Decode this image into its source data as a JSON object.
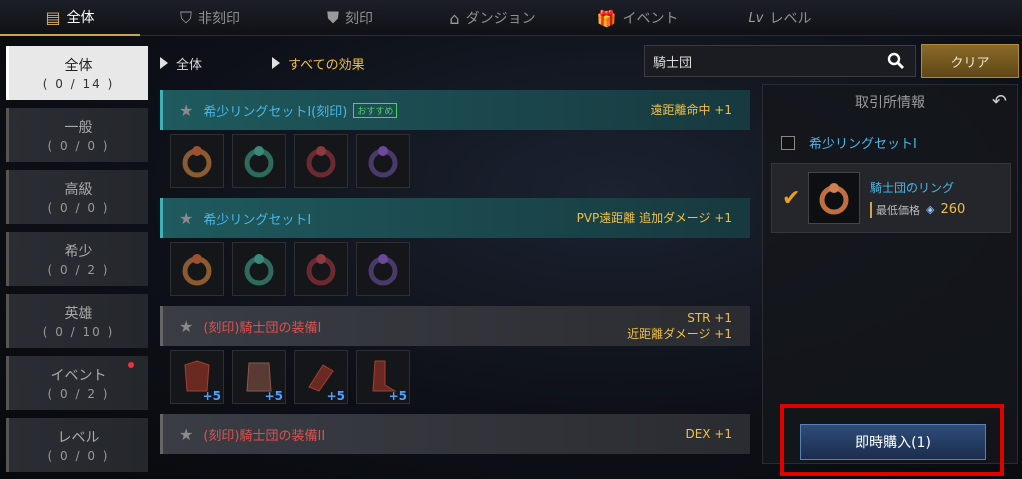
{
  "tabs": [
    {
      "label": "全体",
      "icon": "scroll-icon",
      "active": true
    },
    {
      "label": "非刻印",
      "icon": "unengraved-icon"
    },
    {
      "label": "刻印",
      "icon": "engraved-icon"
    },
    {
      "label": "ダンジョン",
      "icon": "dungeon-icon"
    },
    {
      "label": "イベント",
      "icon": "gift-icon"
    },
    {
      "label": "レベル",
      "icon": "level-icon",
      "icon_text": "Lv"
    }
  ],
  "categories": [
    {
      "label": "全体",
      "count": "( 0 / 14 )",
      "active": true
    },
    {
      "label": "一般",
      "count": "( 0 / 0 )"
    },
    {
      "label": "高級",
      "count": "( 0 / 0 )"
    },
    {
      "label": "希少",
      "count": "( 0 / 2 )"
    },
    {
      "label": "英雄",
      "count": "( 0 / 10 )"
    },
    {
      "label": "イベント",
      "count": "( 0 / 2 )",
      "dot": true
    },
    {
      "label": "レベル",
      "count": "( 0 / 0 )"
    }
  ],
  "filters": {
    "f1": "全体",
    "f2": "すべての効果"
  },
  "search": {
    "value": "騎士団"
  },
  "clear_label": "クリア",
  "sets": [
    {
      "name": "希少リングセットI(刻印)",
      "badge": "おすすめ",
      "effects": [
        "遠距離命中 +1"
      ],
      "style": "teal",
      "color": "blue",
      "items": [
        "ring-orange",
        "ring-green",
        "ring-red",
        "ring-purple"
      ]
    },
    {
      "name": "希少リングセットI",
      "effects": [
        "PVP遠距離 追加ダメージ +1"
      ],
      "style": "teal",
      "color": "blue",
      "items": [
        "ring-orange",
        "ring-green",
        "ring-red",
        "ring-purple"
      ]
    },
    {
      "name": "(刻印)騎士団の装備I",
      "effects": [
        "STR +1",
        "近距離ダメージ +1"
      ],
      "style": "gray",
      "color": "red",
      "items": [
        "armor",
        "armor",
        "gloves",
        "boots"
      ],
      "plus": "+5"
    },
    {
      "name": "(刻印)騎士団の装備II",
      "effects": [
        "DEX +1"
      ],
      "style": "gray",
      "color": "red",
      "items": []
    }
  ],
  "panel": {
    "title": "取引所情報",
    "row1": "希少リングセットI",
    "item_name": "騎士団のリング",
    "price_label": "最低価格",
    "price": "260"
  },
  "buy_label": "即時購入(1)",
  "colors": {
    "accent": "#f0c040",
    "link": "#4ab8e8",
    "highlight": "#e00000"
  }
}
